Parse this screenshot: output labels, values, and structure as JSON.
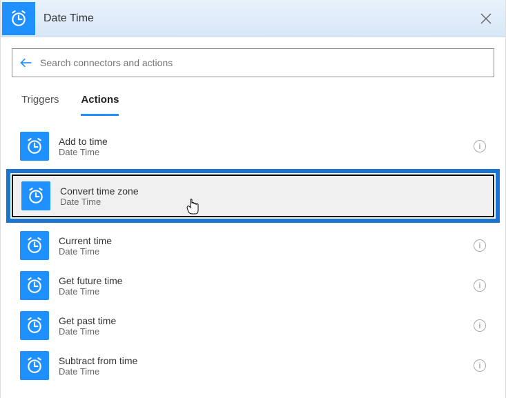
{
  "header": {
    "title": "Date Time",
    "icon": "alarm-clock-icon",
    "close_label": "Close",
    "accent_color": "#1e90ff"
  },
  "search": {
    "placeholder": "Search connectors and actions",
    "value": "",
    "back_icon": "back-arrow-icon"
  },
  "tabs": {
    "items": [
      {
        "label": "Triggers",
        "active": false
      },
      {
        "label": "Actions",
        "active": true
      }
    ]
  },
  "actions": {
    "items": [
      {
        "title": "Add to time",
        "subtitle": "Date Time",
        "icon": "alarm-clock-icon",
        "selected": false
      },
      {
        "title": "Convert time zone",
        "subtitle": "Date Time",
        "icon": "alarm-clock-icon",
        "selected": true
      },
      {
        "title": "Current time",
        "subtitle": "Date Time",
        "icon": "alarm-clock-icon",
        "selected": false
      },
      {
        "title": "Get future time",
        "subtitle": "Date Time",
        "icon": "alarm-clock-icon",
        "selected": false
      },
      {
        "title": "Get past time",
        "subtitle": "Date Time",
        "icon": "alarm-clock-icon",
        "selected": false
      },
      {
        "title": "Subtract from time",
        "subtitle": "Date Time",
        "icon": "alarm-clock-icon",
        "selected": false
      }
    ],
    "info_tooltip": "i"
  }
}
